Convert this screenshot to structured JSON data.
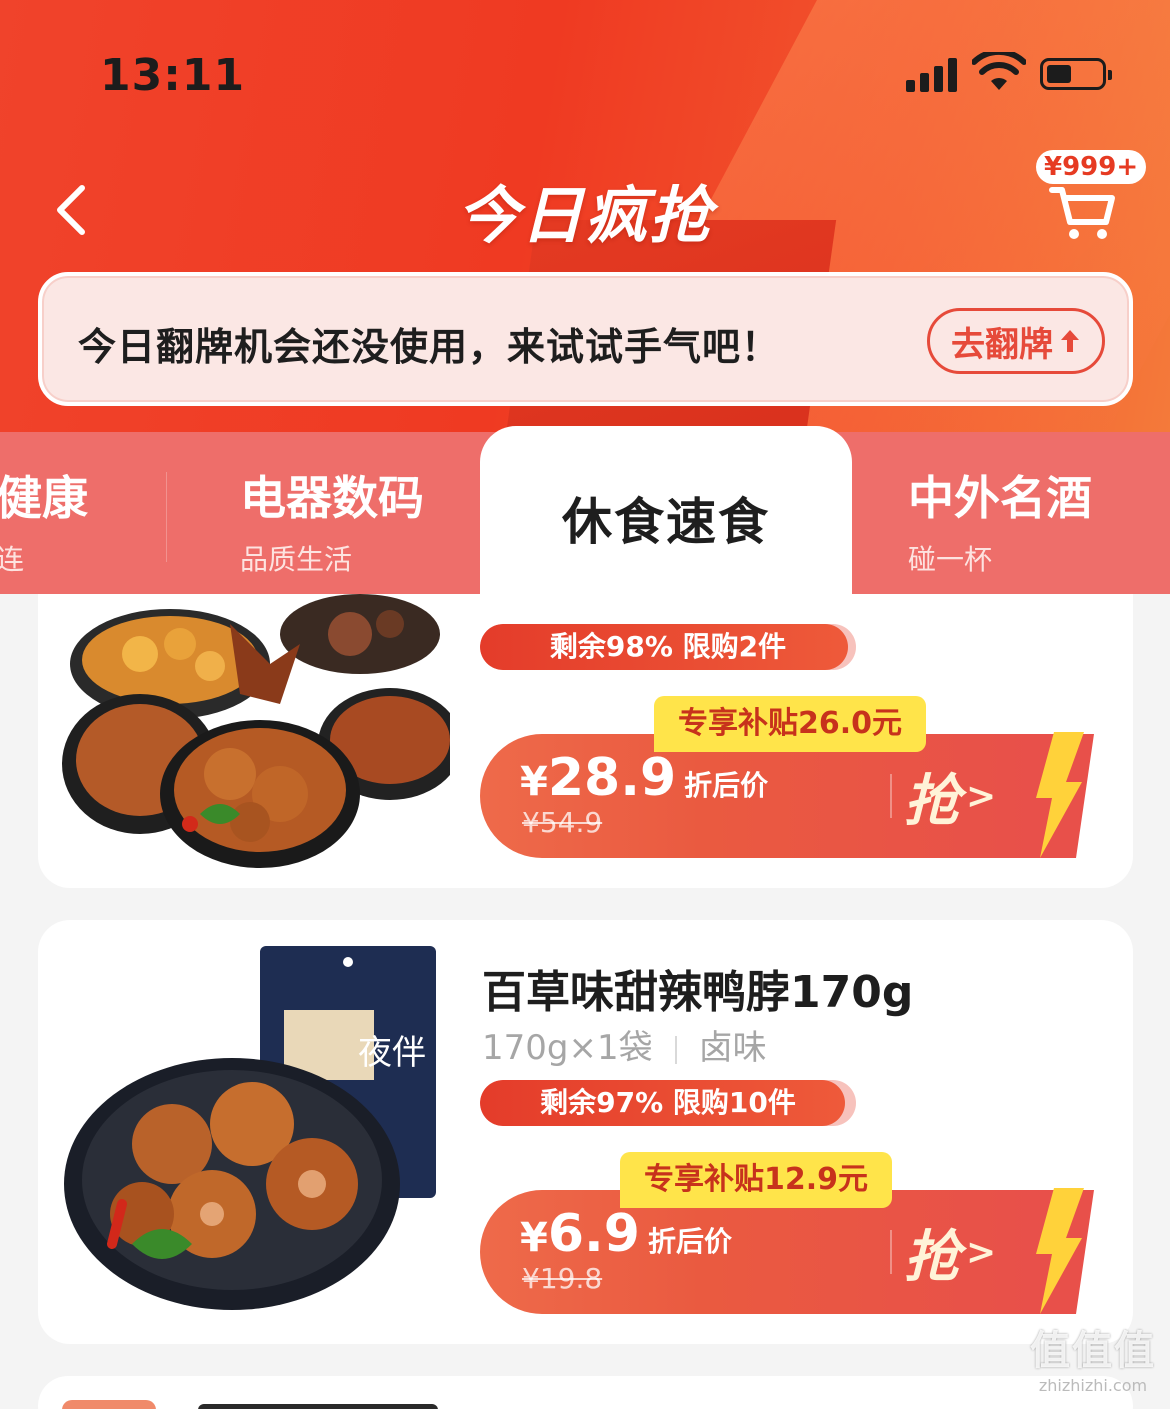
{
  "status_bar": {
    "time": "13:11"
  },
  "header": {
    "title": "今日疯抢",
    "cart_badge": "¥999+"
  },
  "notice": {
    "text": "今日翻牌机会还没使用，来试试手气吧！",
    "button_label": "去翻牌"
  },
  "tabs": [
    {
      "title": "健康",
      "subtitle": "连"
    },
    {
      "title": "电器数码",
      "subtitle": "品质生活"
    },
    {
      "title": "休食速食",
      "subtitle": ""
    },
    {
      "title": "中外名酒",
      "subtitle": "碰一杯"
    }
  ],
  "products": [
    {
      "stock": "剩余98%  限购2件",
      "stock_remaining": 0.98,
      "subsidy": "专享补贴26.0元",
      "price_yen": "¥",
      "price": "28.9",
      "price_label": "折后价",
      "old_price": "¥54.9",
      "grab_label": "抢"
    },
    {
      "title": "百草味甜辣鸭脖170g",
      "spec": "170g×1袋",
      "flavor": "卤味",
      "stock": "剩余97%  限购10件",
      "stock_remaining": 0.97,
      "subsidy": "专享补贴12.9元",
      "price_yen": "¥",
      "price": "6.9",
      "price_label": "折后价",
      "old_price": "¥19.8",
      "grab_label": "抢",
      "package_text": "夜伴"
    }
  ],
  "watermark": {
    "line1": "值值值",
    "line2": "zhizhizhi.com"
  }
}
